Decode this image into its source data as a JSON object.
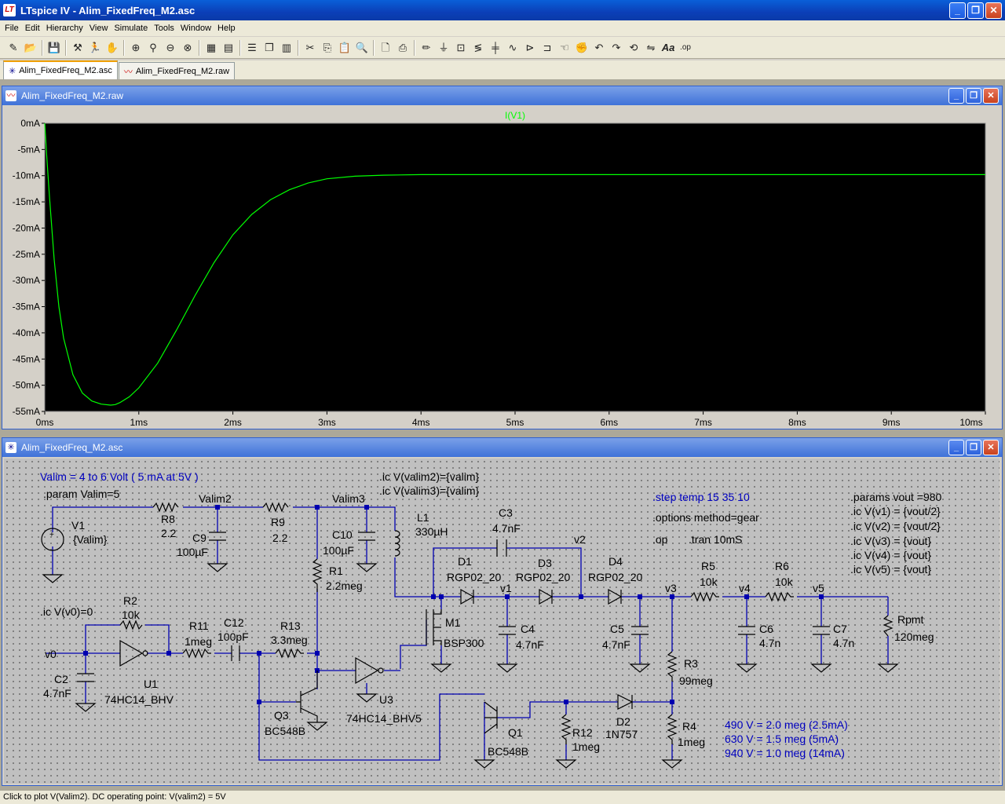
{
  "app": {
    "title": "LTspice IV - Alim_FixedFreq_M2.asc",
    "logo_text": "LT",
    "min_symbol": "_",
    "max_symbol": "❐",
    "close_symbol": "✕"
  },
  "menu": [
    "File",
    "Edit",
    "Hierarchy",
    "View",
    "Simulate",
    "Tools",
    "Window",
    "Help"
  ],
  "toolbar_icons": [
    "new-schematic",
    "open",
    "save",
    "control-panel",
    "pan",
    "zoom-in",
    "zoom-pan",
    "zoom-out",
    "zoom-fit",
    "autorange",
    "autorange-y",
    "tile-horizontal",
    "cascade",
    "tile-vertical",
    "cut",
    "copy",
    "paste",
    "find",
    "print-preview",
    "print",
    "draw-wire",
    "ground",
    "label-net",
    "resistor",
    "capacitor",
    "inductor",
    "diode",
    "component",
    "move",
    "drag",
    "undo",
    "redo",
    "rotate",
    "mirror",
    "text",
    "spice-directive"
  ],
  "tabs": [
    {
      "label": "Alim_FixedFreq_M2.asc",
      "icon": "schematic-icon",
      "active": true
    },
    {
      "label": "Alim_FixedFreq_M2.raw",
      "icon": "waveform-icon",
      "active": false
    }
  ],
  "waveform": {
    "window_title": "Alim_FixedFreq_M2.raw",
    "trace_label": "I(V1)",
    "trace_color": "#00ff00",
    "background": "#000000"
  },
  "schematic": {
    "window_title": "Alim_FixedFreq_M2.asc",
    "directives": [
      "Valim = 4 to 6 Volt ( 5 mA at 5V )",
      ".param Valim=5",
      ".ic V(valim2)={valim}",
      ".ic V(valim3)={valim}",
      ".step temp 15 35 10",
      ".options method=gear",
      ".op",
      ".tran 10mS",
      ".params vout =980",
      ".ic V(v1) = {vout/2}",
      ".ic V(v2) = {vout/2}",
      ".ic V(v3) = {vout}",
      ".ic V(v4) = {vout}",
      ".ic V(v5) = {vout}",
      ".ic V(v0)=0",
      "490 V = 2.0 meg (2.5mA)",
      "630 V = 1.5 meg (5mA)",
      "940 V = 1.0 meg (14mA)"
    ],
    "labels": [
      "V1",
      "{Valim}",
      "R8",
      "2.2",
      "Valim2",
      "C9",
      "100µF",
      "R9",
      "2.2",
      "Valim3",
      "C10",
      "100µF",
      "L1",
      "330µH",
      "C3",
      "4.7nF",
      "v2",
      "R1",
      "2.2meg",
      "D1",
      "RGP02_20",
      "v1",
      "D3",
      "RGP02_20",
      "D4",
      "RGP02_20",
      "v3",
      "R5",
      "10k",
      "v4",
      "R6",
      "10k",
      "v5",
      "Rpmt",
      "120meg",
      "R2",
      "10k",
      "R11",
      "1meg",
      "C12",
      "100pF",
      "R13",
      "3.3meg",
      "v0",
      "C2",
      "4.7nF",
      "U1",
      "74HC14_BHV",
      "Q3",
      "BC548B",
      "U3",
      "74HC14_BHV5",
      "M1",
      "BSP300",
      "C4",
      "4.7nF",
      "C5",
      "4.7nF",
      "C6",
      "4.7n",
      "C7",
      "4.7n",
      "R3",
      "99meg",
      "Q1",
      "BC548B",
      "R12",
      "1meg",
      "D2",
      "1N757",
      "R4",
      "1meg"
    ]
  },
  "chart_data": {
    "type": "line",
    "title": "I(V1)",
    "xlabel": "",
    "ylabel": "",
    "x_ticks": [
      "0ms",
      "1ms",
      "2ms",
      "3ms",
      "4ms",
      "5ms",
      "6ms",
      "7ms",
      "8ms",
      "9ms",
      "10ms"
    ],
    "y_ticks": [
      "0mA",
      "-5mA",
      "-10mA",
      "-15mA",
      "-20mA",
      "-25mA",
      "-30mA",
      "-35mA",
      "-40mA",
      "-45mA",
      "-50mA",
      "-55mA"
    ],
    "xlim": [
      0,
      10
    ],
    "ylim": [
      -55,
      0
    ],
    "grid": false,
    "series": [
      {
        "name": "I(V1)",
        "color": "#00ff00",
        "x": [
          0,
          0.02,
          0.05,
          0.1,
          0.15,
          0.2,
          0.3,
          0.4,
          0.5,
          0.6,
          0.7,
          0.75,
          0.8,
          0.9,
          1.0,
          1.2,
          1.4,
          1.6,
          1.8,
          2.0,
          2.2,
          2.4,
          2.6,
          2.8,
          3.0,
          3.3,
          3.6,
          4.0,
          4.5,
          5.0,
          6.0,
          7.0,
          8.0,
          9.0,
          10.0
        ],
        "y": [
          0,
          -6,
          -14,
          -26,
          -35,
          -41,
          -48,
          -51.5,
          -53,
          -53.6,
          -53.8,
          -53.7,
          -53.3,
          -52.2,
          -50.5,
          -45.8,
          -39.5,
          -32.8,
          -26.6,
          -21.3,
          -17.4,
          -14.6,
          -12.7,
          -11.4,
          -10.6,
          -10.1,
          -9.9,
          -9.8,
          -9.8,
          -9.8,
          -9.8,
          -9.8,
          -9.8,
          -9.8,
          -9.8
        ]
      }
    ]
  },
  "status": "Click to plot V(Valim2).  DC operating point: V(valim2) = 5V"
}
